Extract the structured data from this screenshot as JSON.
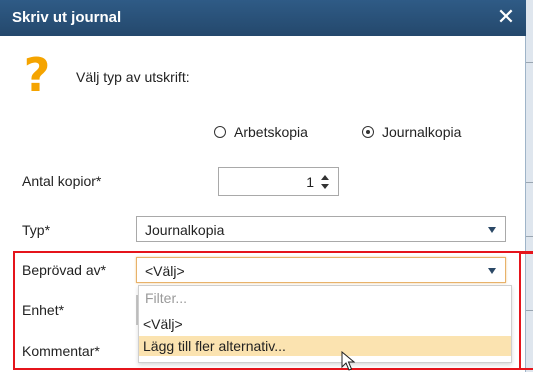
{
  "dialog": {
    "title": "Skriv ut journal",
    "close_icon": "close-icon",
    "prompt_icon": "question-mark-icon",
    "prompt_glyph": "?",
    "prompt": "Välj typ av utskrift:",
    "print_type": {
      "options": [
        {
          "label": "Arbetskopia",
          "selected": false
        },
        {
          "label": "Journalkopia",
          "selected": true
        }
      ]
    },
    "copies": {
      "label": "Antal kopior*",
      "value": "1"
    },
    "type": {
      "label": "Typ*",
      "value": "Journalkopia"
    },
    "reviewed_by": {
      "label": "Beprövad av*",
      "value": "<Välj>"
    },
    "unit": {
      "label": "Enhet*"
    },
    "comment": {
      "label": "Kommentar*"
    }
  },
  "dropdown": {
    "filter_placeholder": "Filter...",
    "options": [
      "<Välj>",
      "Lägg till fler alternativ..."
    ],
    "highlighted_index": 1
  },
  "colors": {
    "titlebar": "#2a5077",
    "accent_question": "#f5a400",
    "highlight_annotation": "#e5141b",
    "option_hover": "#fbe3b0"
  }
}
